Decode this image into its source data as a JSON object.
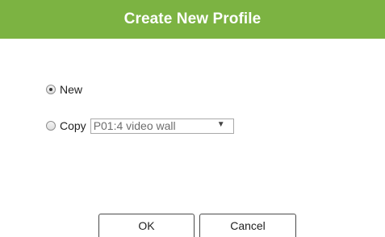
{
  "dialog": {
    "title": "Create New Profile",
    "accent_color": "#7cb342"
  },
  "options": {
    "new_label": "New",
    "copy_label": "Copy",
    "selected": "new"
  },
  "copy_select": {
    "value": "P01:4 video wall",
    "arrow_icon": "triangle-down"
  },
  "buttons": {
    "ok_label": "OK",
    "cancel_label": "Cancel"
  }
}
